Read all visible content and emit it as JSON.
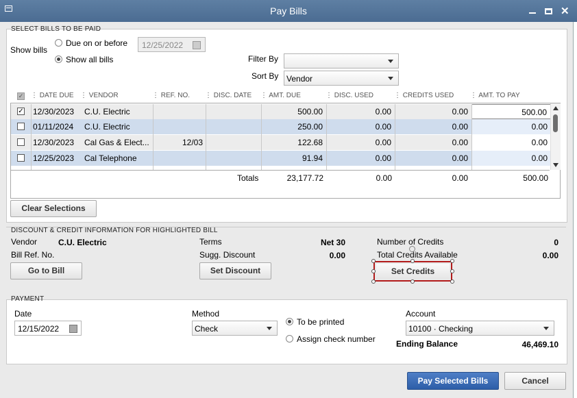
{
  "window": {
    "title": "Pay Bills"
  },
  "select": {
    "section_title": "SELECT BILLS TO BE PAID",
    "show_bills_label": "Show bills",
    "due_on_before_label": "Due on or before",
    "due_date": "12/25/2022",
    "show_all_label": "Show all bills",
    "show_all_selected": true,
    "filter_by_label": "Filter By",
    "filter_by_value": "",
    "sort_by_label": "Sort By",
    "sort_by_value": "Vendor"
  },
  "table": {
    "columns": [
      "DATE DUE",
      "VENDOR",
      "REF. NO.",
      "DISC. DATE",
      "AMT. DUE",
      "DISC. USED",
      "CREDITS USED",
      "AMT. TO PAY"
    ],
    "rows": [
      {
        "checked": true,
        "date_due": "12/30/2023",
        "vendor": "C.U. Electric",
        "ref_no": "",
        "disc_date": "",
        "amt_due": "500.00",
        "disc_used": "0.00",
        "credits_used": "0.00",
        "amt_to_pay": "500.00"
      },
      {
        "checked": false,
        "date_due": "01/11/2024",
        "vendor": "C.U. Electric",
        "ref_no": "",
        "disc_date": "",
        "amt_due": "250.00",
        "disc_used": "0.00",
        "credits_used": "0.00",
        "amt_to_pay": "0.00"
      },
      {
        "checked": false,
        "date_due": "12/30/2023",
        "vendor": "Cal Gas & Elect...",
        "ref_no": "12/03",
        "disc_date": "",
        "amt_due": "122.68",
        "disc_used": "0.00",
        "credits_used": "0.00",
        "amt_to_pay": "0.00"
      },
      {
        "checked": false,
        "date_due": "12/25/2023",
        "vendor": "Cal Telephone",
        "ref_no": "",
        "disc_date": "",
        "amt_due": "91.94",
        "disc_used": "0.00",
        "credits_used": "0.00",
        "amt_to_pay": "0.00"
      }
    ],
    "totals": {
      "label": "Totals",
      "amt_due": "23,177.72",
      "disc_used": "0.00",
      "credits_used": "0.00",
      "amt_to_pay": "500.00"
    },
    "clear_selections_label": "Clear Selections"
  },
  "discount": {
    "section_title": "DISCOUNT & CREDIT INFORMATION FOR HIGHLIGHTED BILL",
    "vendor_label": "Vendor",
    "vendor_value": "C.U. Electric",
    "bill_ref_label": "Bill Ref. No.",
    "terms_label": "Terms",
    "terms_value": "Net 30",
    "sugg_discount_label": "Sugg. Discount",
    "sugg_discount_value": "0.00",
    "num_credits_label": "Number of Credits",
    "num_credits_value": "0",
    "total_credits_label": "Total Credits Available",
    "total_credits_value": "0.00",
    "go_to_bill_label": "Go to Bill",
    "set_discount_label": "Set Discount",
    "set_credits_label": "Set Credits"
  },
  "payment": {
    "section_title": "PAYMENT",
    "date_label": "Date",
    "date_value": "12/15/2022",
    "method_label": "Method",
    "method_value": "Check",
    "to_be_printed_label": "To be printed",
    "assign_check_label": "Assign check number",
    "account_label": "Account",
    "account_value": "10100 · Checking",
    "ending_balance_label": "Ending Balance",
    "ending_balance_value": "46,469.10"
  },
  "footer": {
    "pay_selected_label": "Pay Selected Bills",
    "cancel_label": "Cancel"
  }
}
